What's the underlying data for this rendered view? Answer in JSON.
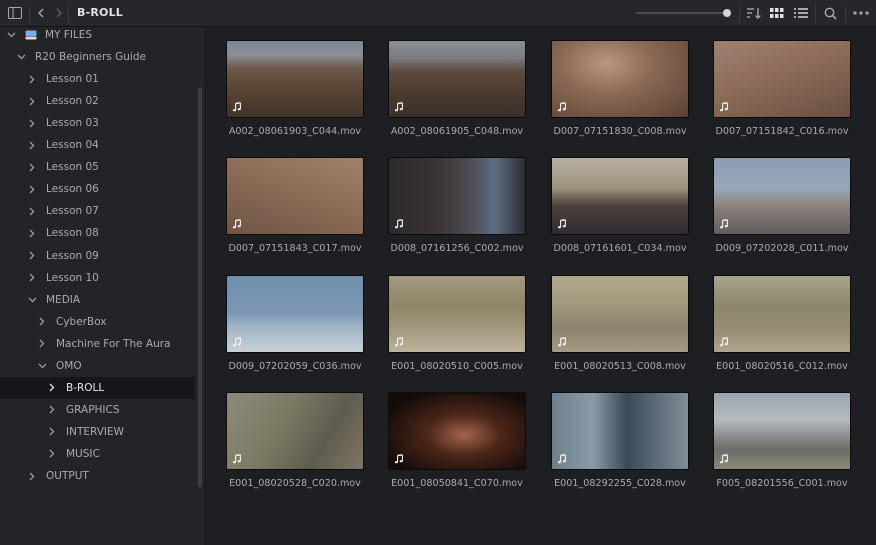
{
  "header": {
    "title": "B-ROLL"
  },
  "sidebar": {
    "items": [
      {
        "label": "MY FILES"
      },
      {
        "label": "R20 Beginners Guide"
      },
      {
        "label": "Lesson 01"
      },
      {
        "label": "Lesson 02"
      },
      {
        "label": "Lesson 03"
      },
      {
        "label": "Lesson 04"
      },
      {
        "label": "Lesson 05"
      },
      {
        "label": "Lesson 06"
      },
      {
        "label": "Lesson 07"
      },
      {
        "label": "Lesson 08"
      },
      {
        "label": "Lesson 09"
      },
      {
        "label": "Lesson 10"
      },
      {
        "label": "MEDIA"
      },
      {
        "label": "CyberBox"
      },
      {
        "label": "Machine For The Aura"
      },
      {
        "label": "OMO"
      },
      {
        "label": "B-ROLL"
      },
      {
        "label": "GRAPHICS"
      },
      {
        "label": "INTERVIEW"
      },
      {
        "label": "MUSIC"
      },
      {
        "label": "OUTPUT"
      }
    ]
  },
  "clips": [
    {
      "name": "A002_08061903_C044.mov"
    },
    {
      "name": "A002_08061905_C048.mov"
    },
    {
      "name": "D007_07151830_C008.mov"
    },
    {
      "name": "D007_07151842_C016.mov"
    },
    {
      "name": "D007_07151843_C017.mov"
    },
    {
      "name": "D008_07161256_C002.mov"
    },
    {
      "name": "D008_07161601_C034.mov"
    },
    {
      "name": "D009_07202028_C011.mov"
    },
    {
      "name": "D009_07202059_C036.mov"
    },
    {
      "name": "E001_08020510_C005.mov"
    },
    {
      "name": "E001_08020513_C008.mov"
    },
    {
      "name": "E001_08020516_C012.mov"
    },
    {
      "name": "E001_08020528_C020.mov"
    },
    {
      "name": "E001_08050841_C070.mov"
    },
    {
      "name": "E001_08292255_C028.mov"
    },
    {
      "name": "F005_08201556_C001.mov"
    }
  ],
  "icons": {
    "sidebar_toggle": "sidebar-toggle-icon",
    "back": "chevron-left-icon",
    "forward": "chevron-right-icon",
    "sort": "sort-icon",
    "grid_view": "grid-view-icon",
    "list_view": "list-view-icon",
    "search": "search-icon",
    "more": "more-options-icon",
    "audio": "music-note-icon"
  },
  "colors": {
    "background": "#1e1f23",
    "sidebar": "#232428",
    "selected_row": "#15161a",
    "text": "#a9abb0"
  }
}
